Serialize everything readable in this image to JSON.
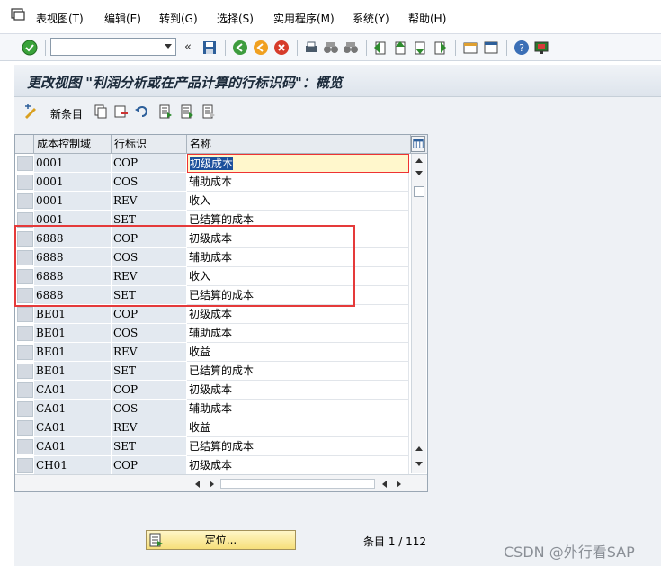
{
  "menubar": {
    "items": [
      "表视图(T)",
      "编辑(E)",
      "转到(G)",
      "选择(S)",
      "实用程序(M)",
      "系统(Y)",
      "帮助(H)"
    ]
  },
  "systoolbar": {
    "command_value": "",
    "icons": [
      "check-icon",
      "save-icon",
      "back-icon",
      "exit-icon",
      "cancel-icon",
      "print-icon",
      "find-icon",
      "find-next-icon",
      "first-page-icon",
      "prev-page-icon",
      "next-page-icon",
      "last-page-icon",
      "create-session-icon",
      "shortcut-icon",
      "help-icon",
      "layout-icon"
    ]
  },
  "title": "更改视图 \"利润分析或在产品计算的行标识码\"：概览",
  "apptoolbar": {
    "new_entries": "新条目",
    "icons": [
      "display-change-icon",
      "copy-icon",
      "delete-icon",
      "undo-icon",
      "select-all-icon",
      "select-block-icon",
      "deselect-all-icon"
    ]
  },
  "table": {
    "columns": [
      "成本控制域",
      "行标识",
      "名称"
    ],
    "rows": [
      [
        "0001",
        "COP",
        "初级成本"
      ],
      [
        "0001",
        "COS",
        "辅助成本"
      ],
      [
        "0001",
        "REV",
        "收入"
      ],
      [
        "0001",
        "SET",
        "已结算的成本"
      ],
      [
        "6888",
        "COP",
        "初级成本"
      ],
      [
        "6888",
        "COS",
        "辅助成本"
      ],
      [
        "6888",
        "REV",
        "收入"
      ],
      [
        "6888",
        "SET",
        "已结算的成本"
      ],
      [
        "BE01",
        "COP",
        "初级成本"
      ],
      [
        "BE01",
        "COS",
        "辅助成本"
      ],
      [
        "BE01",
        "REV",
        "收益"
      ],
      [
        "BE01",
        "SET",
        "已结算的成本"
      ],
      [
        "CA01",
        "COP",
        "初级成本"
      ],
      [
        "CA01",
        "COS",
        "辅助成本"
      ],
      [
        "CA01",
        "REV",
        "收益"
      ],
      [
        "CA01",
        "SET",
        "已结算的成本"
      ],
      [
        "CH01",
        "COP",
        "初级成本"
      ]
    ]
  },
  "footer": {
    "position_button": "定位...",
    "entry_count": "条目 1 / 112"
  },
  "watermark": "CSDN @外行看SAP",
  "colors": {
    "highlight_box": "#e53a3a",
    "title_text": "#1b2a3a",
    "key_column_bg": "#e3e9f0"
  }
}
